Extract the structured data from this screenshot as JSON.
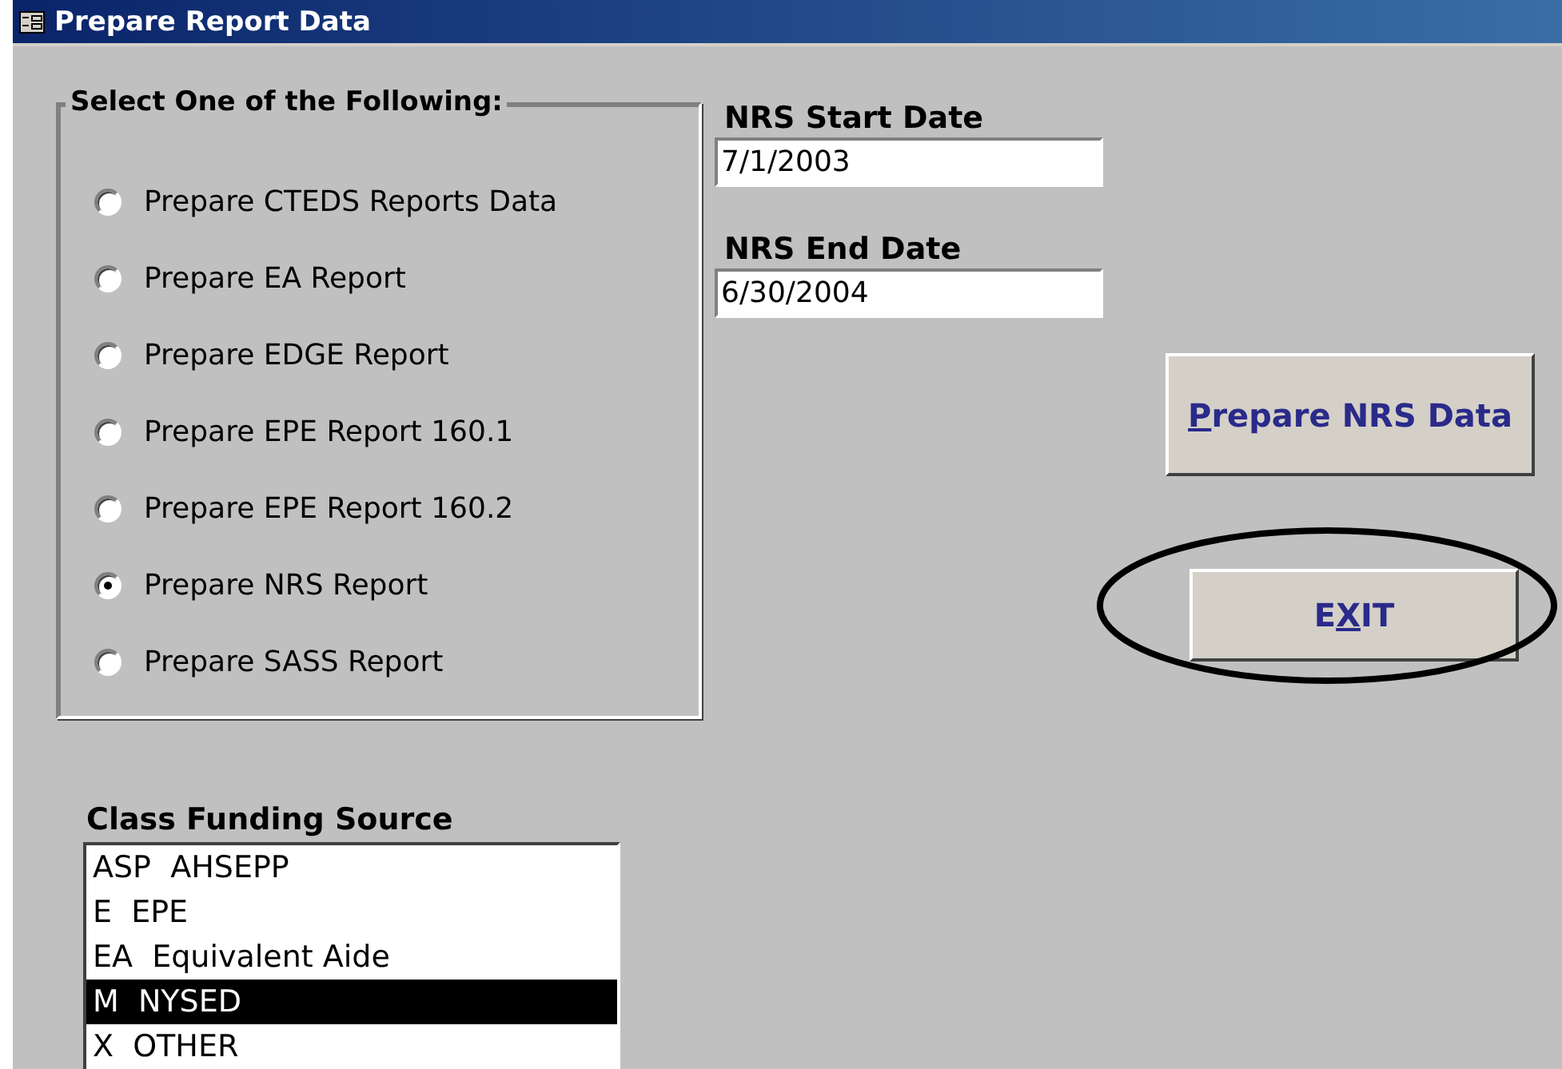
{
  "window": {
    "title": "Prepare Report Data"
  },
  "report_group": {
    "legend": "Select One of the Following:",
    "options": [
      {
        "label": "Prepare CTEDS Reports Data",
        "selected": false
      },
      {
        "label": "Prepare EA Report",
        "selected": false
      },
      {
        "label": "Prepare EDGE Report",
        "selected": false
      },
      {
        "label": "Prepare EPE Report 160.1",
        "selected": false
      },
      {
        "label": "Prepare EPE Report 160.2",
        "selected": false
      },
      {
        "label": "Prepare NRS Report",
        "selected": true
      },
      {
        "label": "Prepare SASS Report",
        "selected": false
      }
    ]
  },
  "dates": [
    {
      "label": "NRS Start Date",
      "value": "7/1/2003"
    },
    {
      "label": "NRS End Date",
      "value": "6/30/2004"
    }
  ],
  "buttons": [
    {
      "access_key": "P",
      "label_after": "repare NRS Data",
      "kind": "large",
      "highlighted": false
    },
    {
      "label_before": "E",
      "access_key": "X",
      "label_after": "IT",
      "kind": "small",
      "highlighted": true
    }
  ],
  "funding": {
    "label": "Class Funding Source",
    "items": [
      {
        "label": "ASP  AHSEPP",
        "selected": false
      },
      {
        "label": "E  EPE",
        "selected": false
      },
      {
        "label": "EA  Equivalent Aide",
        "selected": false
      },
      {
        "label": "M  NYSED",
        "selected": true
      },
      {
        "label": "X  OTHER",
        "selected": false
      }
    ]
  }
}
